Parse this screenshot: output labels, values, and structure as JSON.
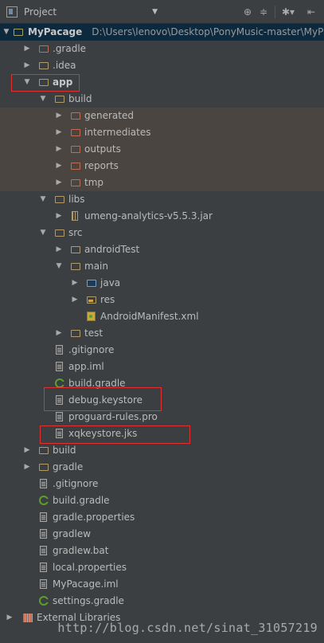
{
  "toolbar": {
    "view_label": "Project",
    "dropdown_icon": "chevron-down-icon",
    "buttons": [
      "locate-icon",
      "collapse-all-icon",
      "settings-icon",
      "hide-icon"
    ]
  },
  "tree": {
    "root_name": "MyPacage",
    "root_path": "D:\\Users\\lenovo\\Desktop\\PonyMusic-master\\MyP",
    "items": [
      {
        "label": ".gradle"
      },
      {
        "label": ".idea"
      },
      {
        "label": "app"
      },
      {
        "label": "build"
      },
      {
        "label": "generated"
      },
      {
        "label": "intermediates"
      },
      {
        "label": "outputs"
      },
      {
        "label": "reports"
      },
      {
        "label": "tmp"
      },
      {
        "label": "libs"
      },
      {
        "label": "umeng-analytics-v5.5.3.jar"
      },
      {
        "label": "src"
      },
      {
        "label": "androidTest"
      },
      {
        "label": "main"
      },
      {
        "label": "java"
      },
      {
        "label": "res"
      },
      {
        "label": "AndroidManifest.xml"
      },
      {
        "label": "test"
      },
      {
        "label": ".gitignore"
      },
      {
        "label": "app.iml"
      },
      {
        "label": "build.gradle"
      },
      {
        "label": "debug.keystore"
      },
      {
        "label": "proguard-rules.pro"
      },
      {
        "label": "xqkeystore.jks"
      },
      {
        "label": "build"
      },
      {
        "label": "gradle"
      },
      {
        "label": ".gitignore"
      },
      {
        "label": "build.gradle"
      },
      {
        "label": "gradle.properties"
      },
      {
        "label": "gradlew"
      },
      {
        "label": "gradlew.bat"
      },
      {
        "label": "local.properties"
      },
      {
        "label": "MyPacage.iml"
      },
      {
        "label": "settings.gradle"
      },
      {
        "label": "External Libraries"
      }
    ]
  },
  "watermark": "http://blog.csdn.net/sinat_31057219",
  "colors": {
    "background": "#3c3f41",
    "selection": "#0d293e",
    "highlight_box": "#e03030"
  }
}
